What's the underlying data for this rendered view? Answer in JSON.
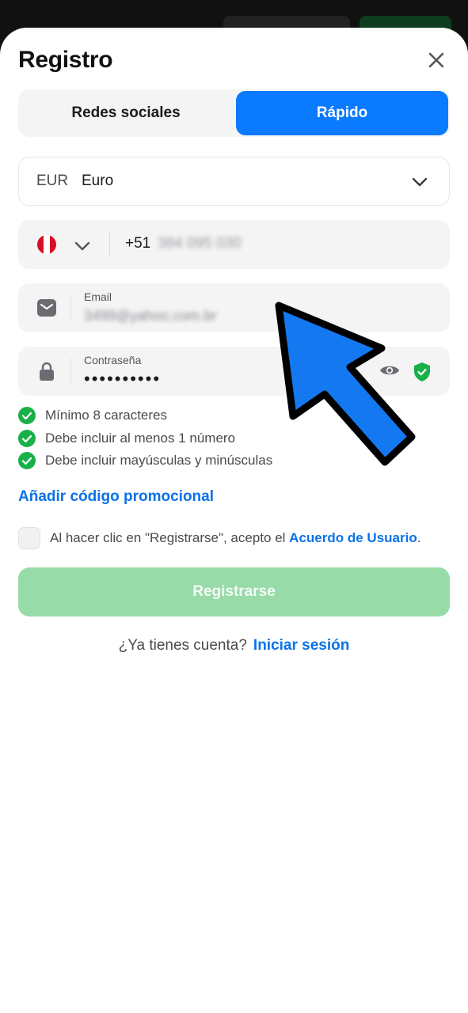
{
  "header": {
    "title": "Registro",
    "close_icon": "close-icon"
  },
  "tabs": [
    {
      "label": "Redes sociales",
      "active": false
    },
    {
      "label": "Rápido",
      "active": true
    }
  ],
  "currency": {
    "code": "EUR",
    "name": "Euro"
  },
  "phone": {
    "country_flag": "peru-flag-icon",
    "prefix": "+51",
    "number": "384 095 030"
  },
  "email": {
    "label": "Email",
    "value": "3499@yahoo.com.br"
  },
  "password": {
    "label": "Contraseña",
    "value": "••••••••••"
  },
  "password_rules": [
    {
      "text": "Mínimo 8 caracteres",
      "met": true
    },
    {
      "text": "Debe incluir al menos 1 número",
      "met": true
    },
    {
      "text": "Debe incluir mayúsculas y minúsculas",
      "met": true
    }
  ],
  "promo_link": "Añadir código promocional",
  "terms": {
    "text": "Al hacer clic en \"Registrarse\", acepto el",
    "link": "Acuerdo de Usuario",
    "suffix": "."
  },
  "submit_label": "Registrarse",
  "login_prompt": {
    "text": "¿Ya tienes cuenta?",
    "link": "Iniciar sesión"
  },
  "colors": {
    "accent": "#0a7aff",
    "link": "#0a72e8",
    "success": "#19b04a",
    "submit_disabled": "#97dba8",
    "annotation_arrow": "#1479f0"
  }
}
